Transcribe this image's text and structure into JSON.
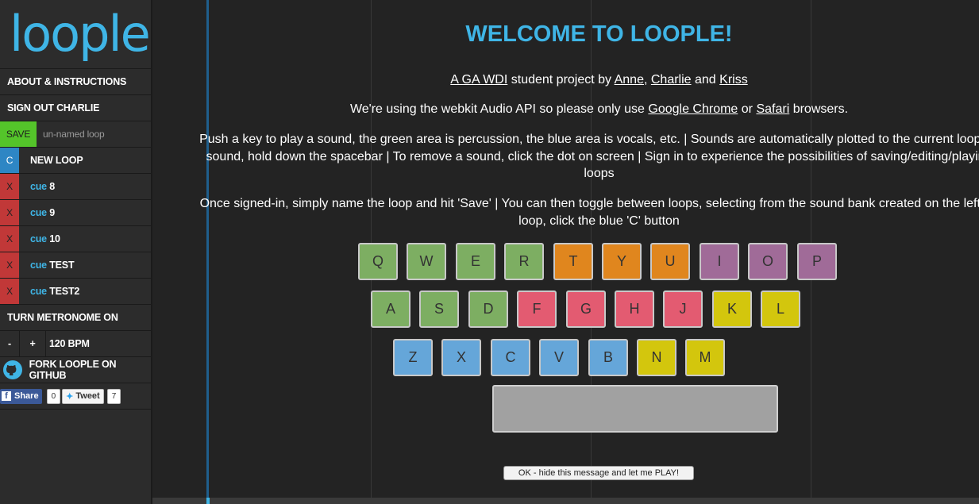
{
  "sidebar": {
    "logo": "loople",
    "about": "ABOUT & INSTRUCTIONS",
    "signout": "SIGN OUT CHARLIE",
    "save_label": "SAVE",
    "loop_name": "un-named loop",
    "new_loop_tag": "C",
    "new_loop_label": "NEW LOOP",
    "remove_tag": "X",
    "cue_prefix": "cue",
    "loops": [
      {
        "name": "8"
      },
      {
        "name": "9"
      },
      {
        "name": "10"
      },
      {
        "name": "TEST"
      },
      {
        "name": "TEST2"
      }
    ],
    "metronome": "TURN METRONOME ON",
    "minus": "-",
    "plus": "+",
    "bpm": "120 BPM",
    "github": "FORK LOOPLE ON GITHUB",
    "share_label": "Share",
    "share_count": "0",
    "tweet_label": "Tweet",
    "tweet_count": "7"
  },
  "welcome": {
    "title": "WELCOME TO LOOPLE!",
    "line1_a": "A GA WDI",
    "line1_b": " student project by ",
    "line1_anne": "Anne",
    "line1_comma": ", ",
    "line1_charlie": "Charlie",
    "line1_and": " and ",
    "line1_kriss": "Kriss",
    "line2_a": "We're using the webkit Audio API so please only use ",
    "line2_chrome": "Google Chrome",
    "line2_or": " or ",
    "line2_safari": "Safari",
    "line2_b": " browsers.",
    "para3_l1": "Push a key to play a sound, the green area is percussion, the blue area is vocals, etc. | Sounds are automatically plotted to the current loop | T",
    "para3_l2": "sound, hold down the spacebar | To remove a sound, click the dot on screen | Sign in to experience the possibilities of saving/editing/playing",
    "para3_l3": "loops",
    "para4_l1": "Once signed-in, simply name the loop and hit 'Save' | You can then toggle between loops, selecting from the sound bank created on the left | T",
    "para4_l2": "loop, click the blue 'C' button",
    "ok_button": "OK - hide this message and let me PLAY!"
  },
  "keyboard": {
    "row1": [
      "Q",
      "W",
      "E",
      "R",
      "T",
      "Y",
      "U",
      "I",
      "O",
      "P"
    ],
    "row2": [
      "A",
      "S",
      "D",
      "F",
      "G",
      "H",
      "J",
      "K",
      "L"
    ],
    "row3": [
      "Z",
      "X",
      "C",
      "V",
      "B",
      "N",
      "M"
    ]
  },
  "colors": {
    "accent": "#3fb5e6",
    "percussion": "#7dae62",
    "orange": "#e0861e",
    "purple": "#a06b98",
    "red": "#e35b71",
    "yellow": "#d3c60d",
    "vocals": "#65a6d9",
    "save": "#54c42a",
    "remove": "#c13838"
  }
}
